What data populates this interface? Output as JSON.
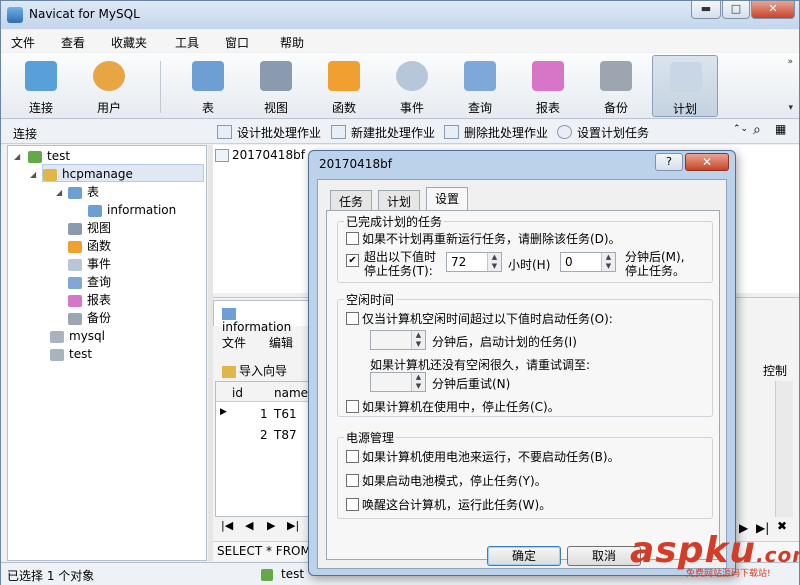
{
  "window": {
    "title": "Navicat for MySQL",
    "min": "▬",
    "max": "□",
    "close": "✕"
  },
  "menu": [
    "文件",
    "查看",
    "收藏夹",
    "工具",
    "窗口",
    "帮助"
  ],
  "toolbar": {
    "items": [
      {
        "label": "连接",
        "icon": "plug-icon",
        "color": "#5aa0d8"
      },
      {
        "label": "用户",
        "icon": "user-icon",
        "color": "#e8a544"
      },
      {
        "label": "表",
        "icon": "table-icon",
        "color": "#6e9fd4"
      },
      {
        "label": "视图",
        "icon": "view-icon",
        "color": "#8a9bb0"
      },
      {
        "label": "函数",
        "icon": "function-icon",
        "color": "#f0a030"
      },
      {
        "label": "事件",
        "icon": "clock-icon",
        "color": "#b7c6d8"
      },
      {
        "label": "查询",
        "icon": "query-icon",
        "color": "#7ea8d8"
      },
      {
        "label": "报表",
        "icon": "report-icon",
        "color": "#d776c7"
      },
      {
        "label": "备份",
        "icon": "backup-icon",
        "color": "#9da6b0"
      },
      {
        "label": "计划",
        "icon": "schedule-icon",
        "color": "#c9d6e5"
      }
    ]
  },
  "connbar": {
    "label": "连接",
    "actions": [
      "设计批处理作业",
      "新建批处理作业",
      "删除批处理作业",
      "设置计划任务"
    ]
  },
  "tree": {
    "root": "test",
    "db": "hcpmanage",
    "table_folder": "表",
    "table": "information",
    "folders": [
      "视图",
      "函数",
      "事件",
      "查询",
      "报表",
      "备份"
    ],
    "other_dbs": [
      "mysql",
      "test"
    ]
  },
  "object_item": "20170418bf",
  "info": {
    "tab": "information",
    "menu_file": "文件",
    "menu_edit": "编辑",
    "import": "导入向导",
    "right_label": "控制",
    "cols": [
      "id",
      "name"
    ],
    "rows": [
      [
        "1",
        "T61"
      ],
      [
        "2",
        "T87"
      ]
    ],
    "sql": "SELECT * FROM"
  },
  "status": {
    "left": "已选择 1 个对象",
    "conn": "test"
  },
  "dialog": {
    "title": "20170418bf",
    "help": "?",
    "close": "✕",
    "tabs": [
      "任务",
      "计划",
      "设置"
    ],
    "group1": {
      "label": "已完成计划的任务",
      "opt1": "如果不计划再重新运行任务，请删除该任务(D)。",
      "opt2_line1": "超出以下值时",
      "opt2_line2": "停止任务(T):",
      "hours_value": "72",
      "hours_label": "小时(H)",
      "minutes_value": "0",
      "after_line1": "分钟后(M),",
      "after_line2": "停止任务。"
    },
    "group2": {
      "label": "空闲时间",
      "opt1": "仅当计算机空闲时间超过以下值时启动任务(O):",
      "after1": "分钟后，启动计划的任务(I)",
      "retry": "如果计算机还没有空闲很久，请重试调至:",
      "after2": "分钟后重试(N)",
      "opt2": "如果计算机在使用中，停止任务(C)。"
    },
    "group3": {
      "label": "电源管理",
      "opt1": "如果计算机使用电池来运行，不要启动任务(B)。",
      "opt2": "如果启动电池模式，停止任务(Y)。",
      "opt3": "唤醒这台计算机，运行此任务(W)。"
    },
    "ok": "确定",
    "cancel": "取消"
  },
  "watermark": {
    "text": "aspku",
    "tld": ".com",
    "sub": "免费网站源码下载站!"
  }
}
